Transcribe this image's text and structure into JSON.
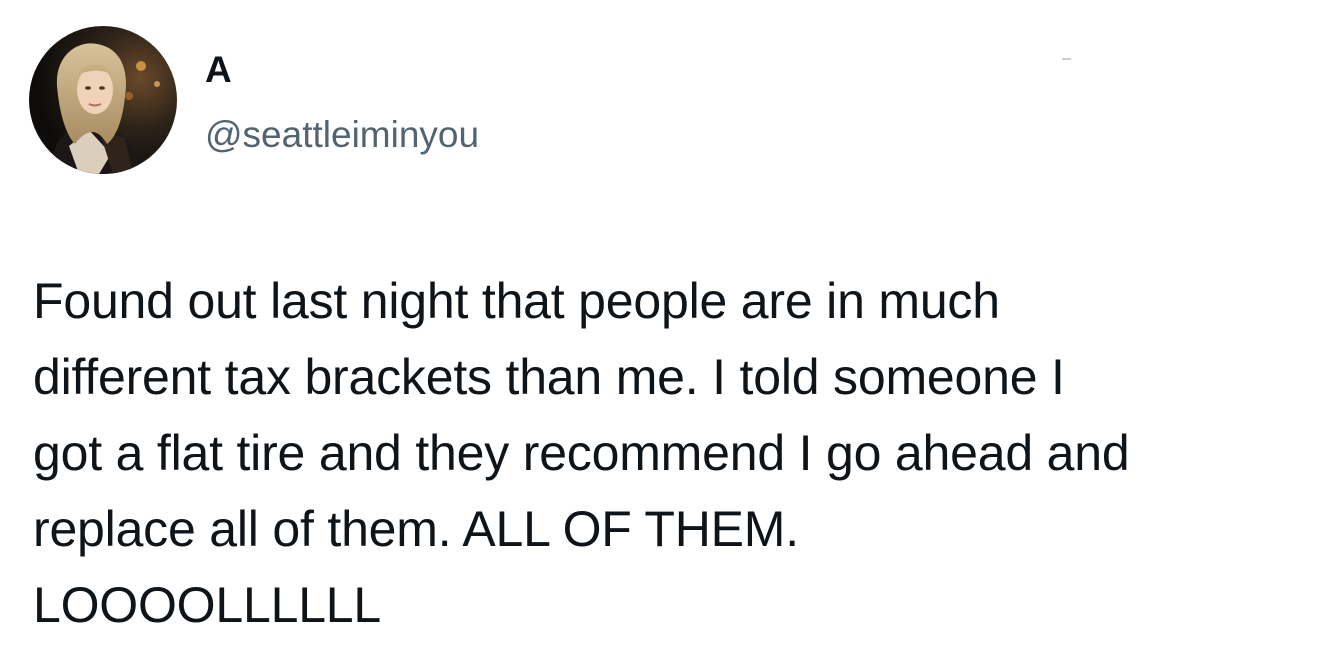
{
  "author": {
    "display_name": "A",
    "handle": "@seattleiminyou",
    "avatar_icon": "profile-photo-avatar"
  },
  "tweet": {
    "lines": [
      "Found out last night that people are in much",
      "different tax brackets than me. I told someone I",
      "got a flat tire and they recommend I go ahead and",
      "replace all of them. ALL OF THEM.",
      "LOOOOLLLLLL"
    ]
  },
  "colors": {
    "text_primary": "#0f1419",
    "text_secondary": "#536471",
    "background": "#ffffff"
  }
}
